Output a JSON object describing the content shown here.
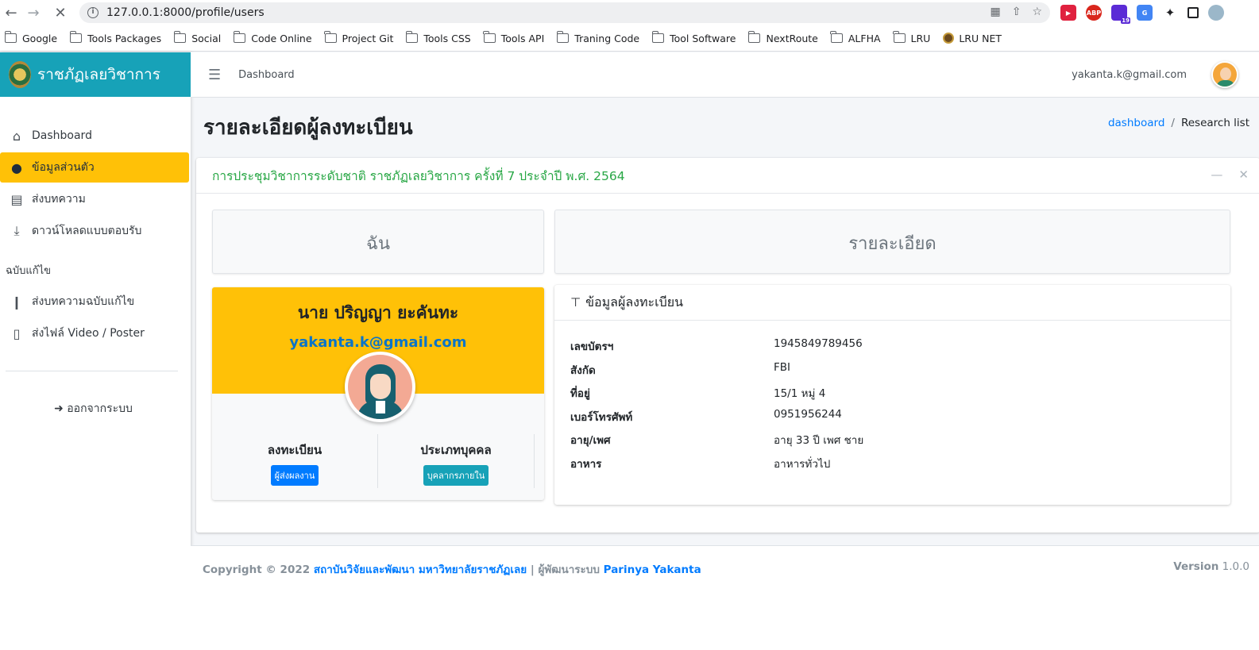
{
  "browser": {
    "url": "127.0.0.1:8000/profile/users",
    "bookmarks": [
      "Google",
      "Tools Packages",
      "Social",
      "Code Online",
      "Project Git",
      "Tools CSS",
      "Tools API",
      "Traning Code",
      "Tool Software",
      "NextRoute",
      "ALFHA",
      "LRU",
      "LRU NET"
    ],
    "ext_badge": "19"
  },
  "sidebar": {
    "brand": "ราชภัฏเลยวิชาการ",
    "items": [
      {
        "label": "Dashboard",
        "icon": "home-icon"
      },
      {
        "label": "ข้อมูลส่วนตัว",
        "icon": "user-circle-icon"
      },
      {
        "label": "ส่งบทความ",
        "icon": "book-icon"
      },
      {
        "label": "ดาวน์โหลดแบบตอบรับ",
        "icon": "download-icon"
      }
    ],
    "section_header": "ฉบับแก้ไข",
    "items2": [
      {
        "label": "ส่งบทความฉบับแก้ไข",
        "icon": "bookmark-icon"
      },
      {
        "label": "ส่งไฟล์ Video / Poster",
        "icon": "file-icon"
      }
    ],
    "logout": "ออกจากระบบ"
  },
  "topnav": {
    "dashboard": "Dashboard",
    "email": "yakanta.k@gmail.com"
  },
  "content": {
    "title": "รายละเอียดผู้ลงทะเบียน",
    "breadcrumb": {
      "link": "dashboard",
      "separator": "/",
      "current": "Research list"
    }
  },
  "card": {
    "title": "การประชุมวิชาการระดับชาติ ราชภัฏเลยวิชาการ ครั้งที่ 7 ประจำปี พ.ศ. 2564",
    "box_left": "ฉัน",
    "box_right": "รายละเอียด"
  },
  "profile": {
    "name": "นาย ปริญญา ยะคันทะ",
    "email": "yakanta.k@gmail.com",
    "stats": [
      {
        "heading": "ลงทะเบียน",
        "badge": "ผู้ส่งผลงาน"
      },
      {
        "heading": "ประเภทบุคคล",
        "badge": "บุคลากรภายใน"
      }
    ]
  },
  "details": {
    "heading": "ข้อมูลผู้ลงทะเบียน",
    "rows": [
      {
        "key": "เลขบัตรฯ",
        "value": "1945849789456"
      },
      {
        "key": "สังกัด",
        "value": "FBI"
      },
      {
        "key": "ที่อยู่",
        "value": "15/1 หมู่ 4"
      },
      {
        "key": "เบอร์โทรศัพท์",
        "value": "0951956244"
      },
      {
        "key": "อายุ/เพศ",
        "value": "อายุ 33 ปี เพศ ชาย"
      },
      {
        "key": "อาหาร",
        "value": "อาหารทั่วไป"
      }
    ]
  },
  "footer": {
    "copyright": "Copyright © 2022",
    "org": "สถาบันวิจัยและพัฒนา มหาวิทยาลัยราชภัฏเลย",
    "dev_prefix": "| ผู้พัฒนาระบบ",
    "dev_name": "Parinya Yakanta",
    "version_label": "Version",
    "version": "1.0.0"
  },
  "colors": {
    "brand": "#17a2b8",
    "active": "#ffc107",
    "title_green": "#28a745",
    "link": "#007bff"
  }
}
